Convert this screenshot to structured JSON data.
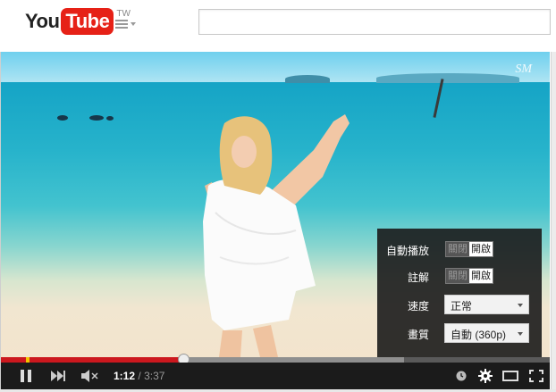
{
  "header": {
    "logo_you": "You",
    "logo_tube": "Tube",
    "logo_region": "TW",
    "search_placeholder": ""
  },
  "video": {
    "watermark": "SM"
  },
  "settings": {
    "autoplay": {
      "label": "自動播放",
      "off": "關閉",
      "on": "開啟",
      "state": "on"
    },
    "annotations": {
      "label": "註解",
      "off": "關閉",
      "on": "開啟",
      "state": "on"
    },
    "speed": {
      "label": "速度",
      "value": "正常"
    },
    "quality": {
      "label": "畫質",
      "value": "自動 (360p)"
    }
  },
  "player": {
    "current_time": "1:12",
    "separator": "/",
    "duration": "3:37",
    "played_fraction": 0.332,
    "loaded_fraction": 0.735
  },
  "colors": {
    "brand_red": "#e62117",
    "progress_red": "#cc181e",
    "ad_marker": "#f5c300"
  },
  "icons": [
    "pause-icon",
    "next-icon",
    "mute-icon",
    "watch-later-icon",
    "settings-gear-icon",
    "theater-mode-icon",
    "fullscreen-icon",
    "guide-menu-icon"
  ]
}
